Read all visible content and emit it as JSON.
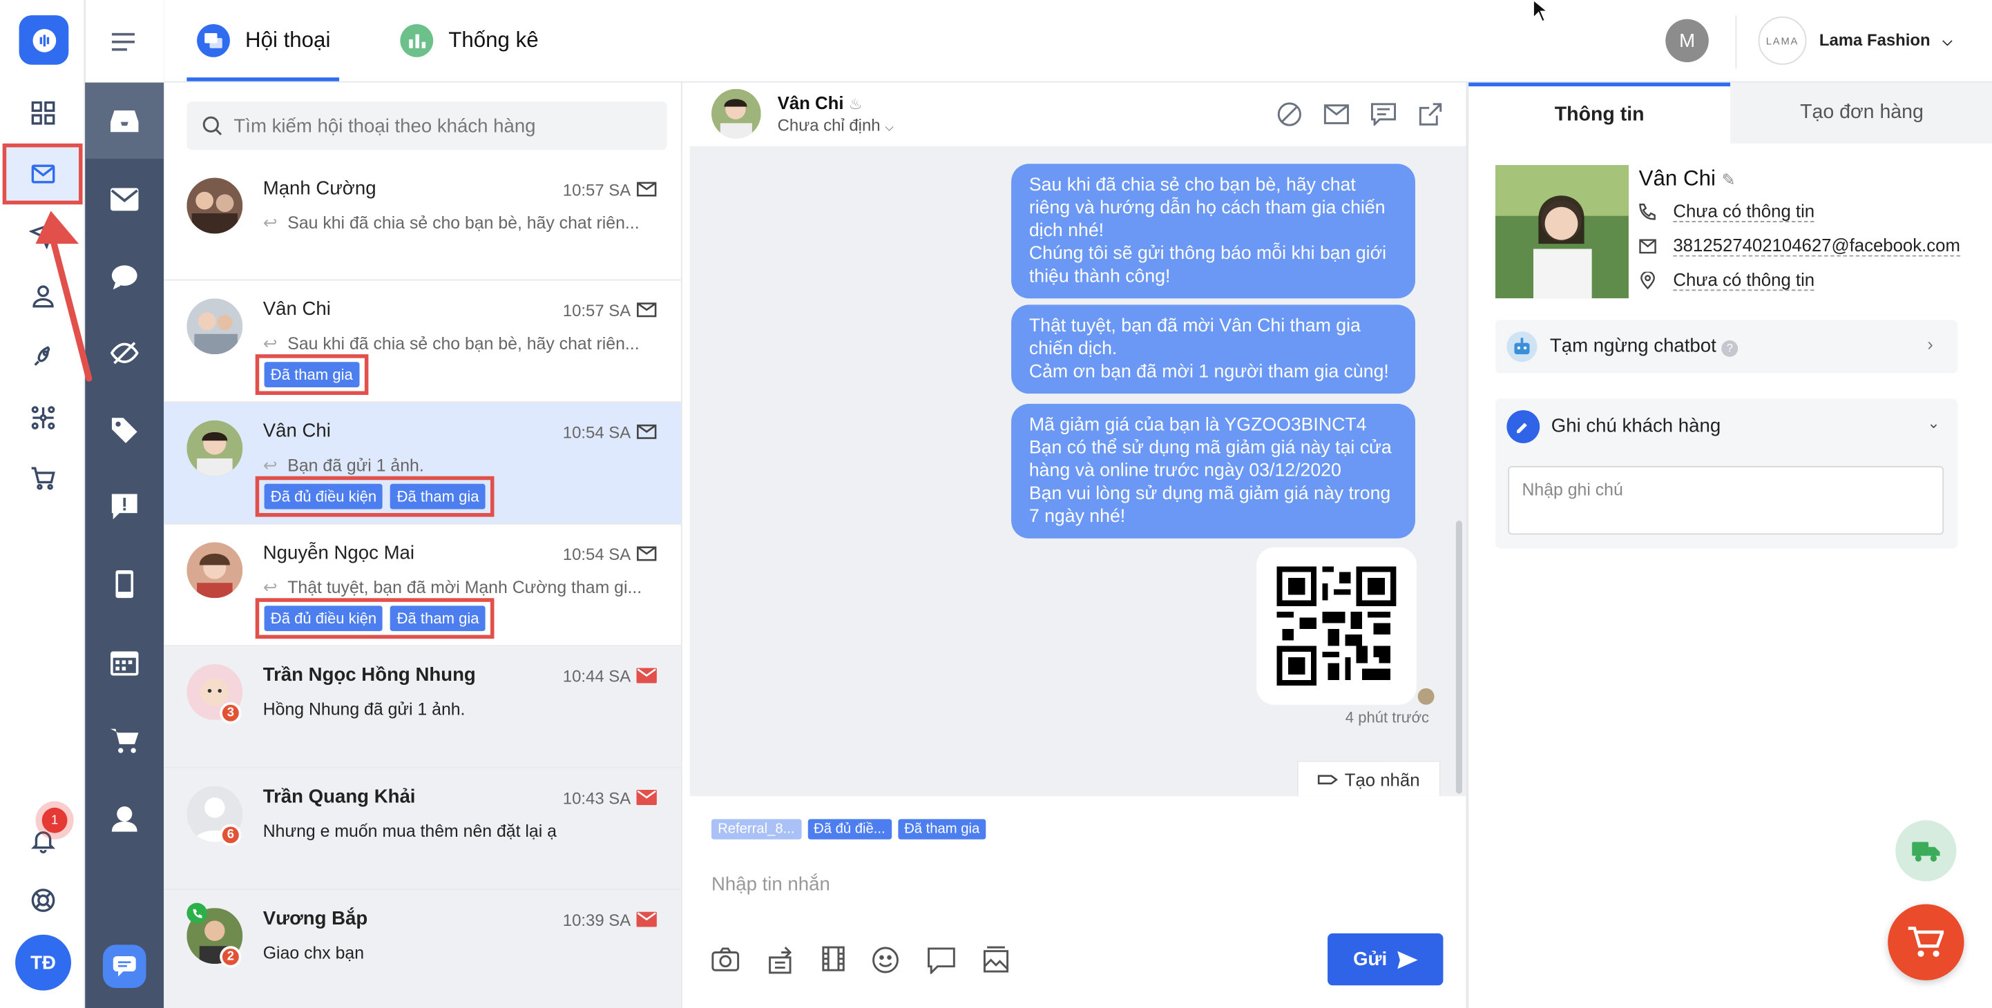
{
  "tabs": [
    {
      "label": "Hội thoại"
    },
    {
      "label": "Thống kê"
    }
  ],
  "header": {
    "user_initial": "M",
    "shop_logo_text": "LAMA",
    "shop_name": "Lama Fashion"
  },
  "rail": {
    "user_initials": "TĐ",
    "notification_count": "1"
  },
  "search": {
    "placeholder": "Tìm kiếm hội thoại theo khách hàng"
  },
  "conversations": [
    {
      "name": "Mạnh Cường",
      "time": "10:57 SA",
      "preview": "Sau khi đã chia sẻ cho bạn bè, hãy chat riên...",
      "tags": []
    },
    {
      "name": "Vân Chi",
      "time": "10:57 SA",
      "preview": "Sau khi đã chia sẻ cho bạn bè, hãy chat riên...",
      "tags": [
        "Đã tham gia"
      ]
    },
    {
      "name": "Vân Chi",
      "time": "10:54 SA",
      "preview": "Bạn đã gửi 1 ảnh.",
      "tags": [
        "Đã đủ điều kiện",
        "Đã tham gia"
      ]
    },
    {
      "name": "Nguyễn Ngọc Mai",
      "time": "10:54 SA",
      "preview": "Thật tuyệt, bạn đã mời Mạnh Cường tham gi...",
      "tags": [
        "Đã đủ điều kiện",
        "Đã tham gia"
      ]
    },
    {
      "name": "Trần Ngọc Hồng Nhung",
      "time": "10:44 SA",
      "preview": "Hồng Nhung đã gửi 1 ảnh.",
      "badge": "3"
    },
    {
      "name": "Trần Quang Khải",
      "time": "10:43 SA",
      "preview": "Nhưng e muốn mua thêm nên đặt lại ạ",
      "badge": "6"
    },
    {
      "name": "Vương Bắp",
      "time": "10:39 SA",
      "preview": "Giao chx bạn",
      "badge": "2"
    }
  ],
  "chat": {
    "name": "Vân Chi",
    "assign": "Chưa chỉ định",
    "messages": [
      "Sau khi đã chia sẻ cho bạn bè, hãy chat riêng và hướng dẫn họ cách tham gia chiến dịch nhé!\nChúng tôi sẽ gửi thông báo mỗi khi bạn giới thiệu thành công!",
      "Thật tuyệt, bạn đã mời Vân Chi tham gia chiến dịch.\nCảm ơn bạn đã mời 1 người tham gia cùng!",
      "Mã giảm giá của bạn là YGZOO3BINCT4\nBạn có thể sử dụng mã giảm giá này tại cửa hàng và online trước ngày 03/12/2020\nBạn vui lòng sử dụng mã giảm giá này trong 7 ngày nhé!"
    ],
    "time_ago": "4 phút trước",
    "create_tag": "Tạo nhãn",
    "tags": [
      "Referral_8...",
      "Đã đủ điề...",
      "Đã tham gia"
    ],
    "composer_placeholder": "Nhập tin nhắn",
    "send": "Gửi"
  },
  "panel": {
    "tab_info": "Thông tin",
    "tab_order": "Tạo đơn hàng",
    "name": "Vân Chi",
    "phone": "Chưa có thông tin",
    "email": "3812527402104627@facebook.com",
    "address": "Chưa có thông tin",
    "chatbot": "Tạm ngừng chatbot",
    "notes_title": "Ghi chú khách hàng",
    "notes_placeholder": "Nhập ghi chú"
  },
  "colors": {
    "accent": "#2f6cf0",
    "tag": "#4c7ef0",
    "highlight": "#e2504c",
    "sidebar": "#45546c",
    "bubble": "#6b98f5"
  }
}
